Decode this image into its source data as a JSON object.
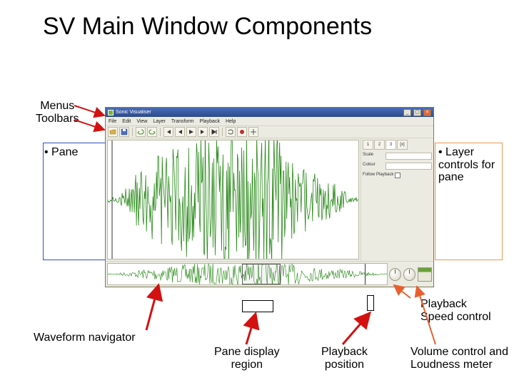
{
  "slide_title": "SV Main Window Components",
  "labels": {
    "menus_toolbars_l1": "Menus",
    "menus_toolbars_l2": "Toolbars",
    "pane": "• Pane",
    "layer_controls_l1": "• Layer",
    "layer_controls_l2": "controls for",
    "layer_controls_l3": "pane",
    "playback_speed_l1": "Playback",
    "playback_speed_l2": "Speed control",
    "waveform_navigator": "Waveform navigator",
    "pane_display_region_l1": "Pane display",
    "pane_display_region_l2": "region",
    "playback_position_l1": "Playback",
    "playback_position_l2": "position",
    "volume_loudness_l1": "Volume control and",
    "volume_loudness_l2": "Loudness meter"
  },
  "app": {
    "title": "Sonic Visualiser",
    "menus": [
      "File",
      "Edit",
      "View",
      "Layer",
      "Transform",
      "Playback",
      "Help"
    ],
    "toolbar_icons": [
      "file-open-icon",
      "save-icon",
      "undo-icon",
      "redo-icon",
      "rewind-start-icon",
      "step-back-icon",
      "play-icon",
      "step-fwd-icon",
      "fast-fwd-end-icon",
      "loop-icon",
      "record-icon",
      "alignment-icon"
    ],
    "layer_tabs": [
      "1",
      "2",
      "3",
      "[x]"
    ],
    "controls": {
      "row1_label": "Scale",
      "row2_label": "Colour",
      "row3_label": "Follow Playback"
    }
  },
  "colors": {
    "arrow_red": "#d31111",
    "arrow_tomato": "#e86030",
    "nav_box": "#3250c8",
    "layer_box": "#e89950",
    "waveform": "#2a8a1a"
  }
}
